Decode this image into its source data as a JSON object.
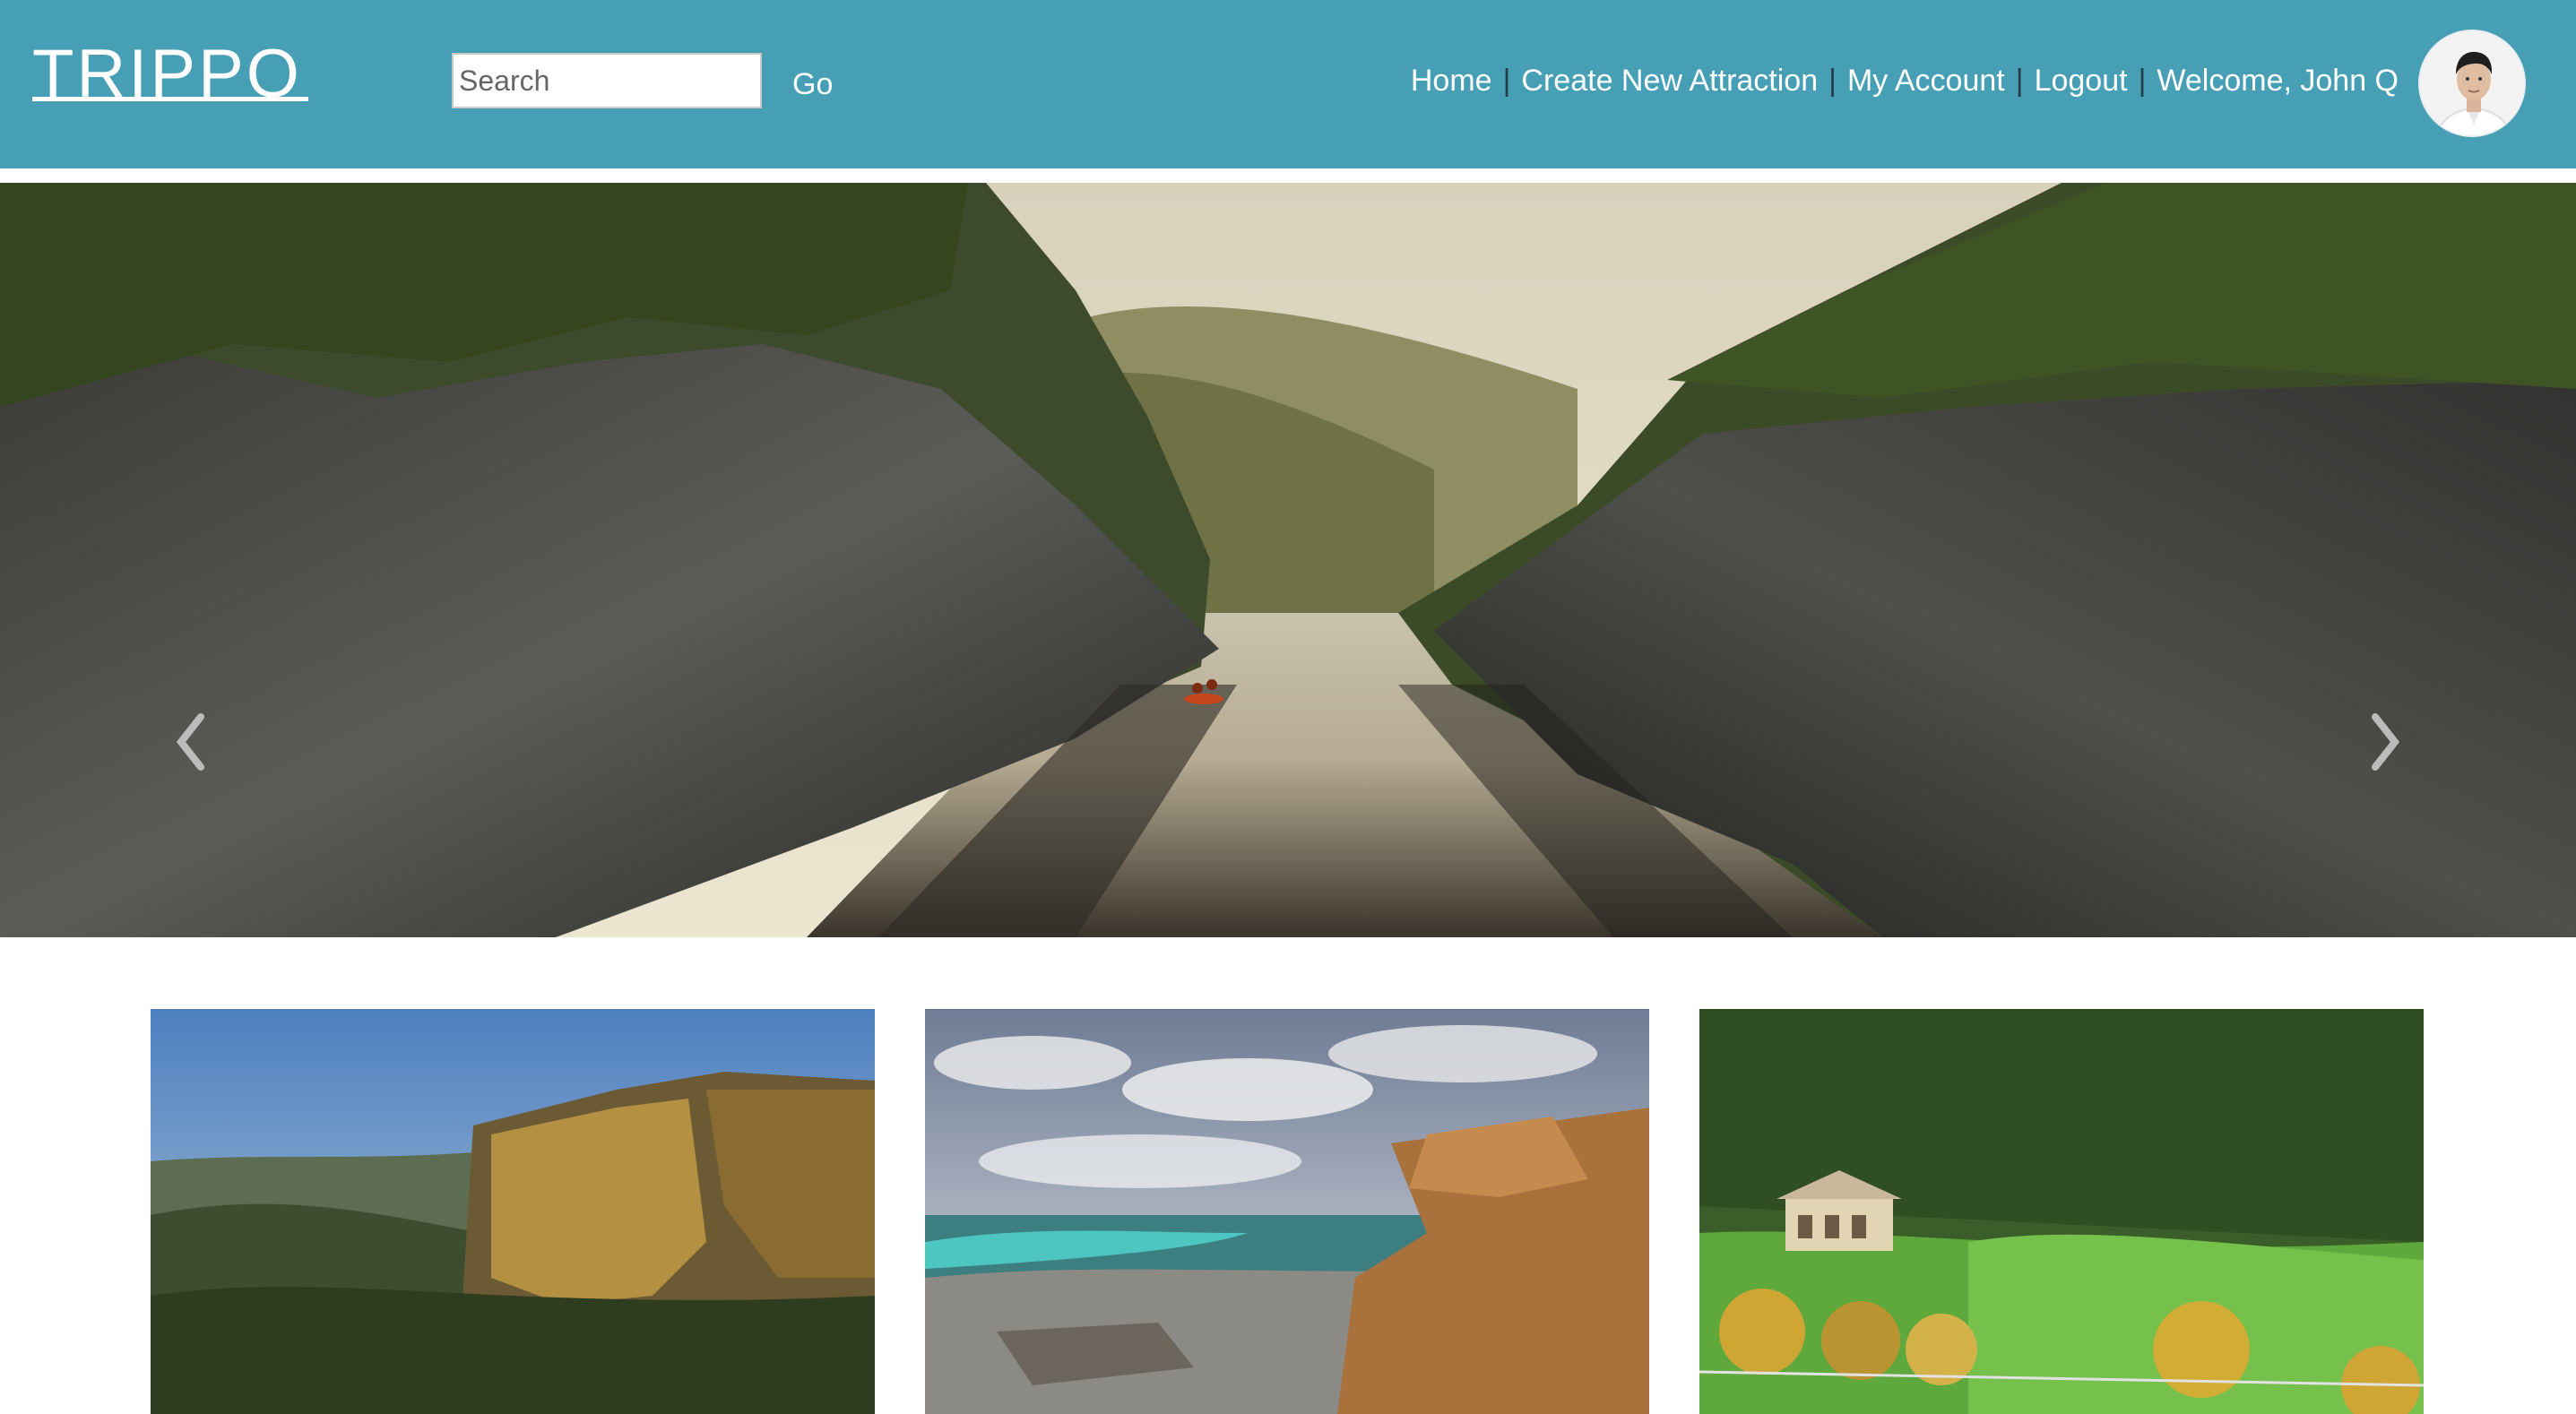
{
  "header": {
    "logo": "TRIPPO",
    "search": {
      "placeholder": "Search",
      "value": ""
    },
    "go_label": "Go",
    "nav": {
      "home": "Home",
      "create": "Create New Attraction",
      "account": "My Account",
      "logout": "Logout",
      "welcome": "Welcome, John Q",
      "separator": "|"
    }
  },
  "carousel": {
    "prev_icon": "chevron-left-icon",
    "next_icon": "chevron-right-icon"
  },
  "colors": {
    "header_bg": "#479fb6",
    "header_text": "#ffffff",
    "nav_separator": "#233e47"
  }
}
